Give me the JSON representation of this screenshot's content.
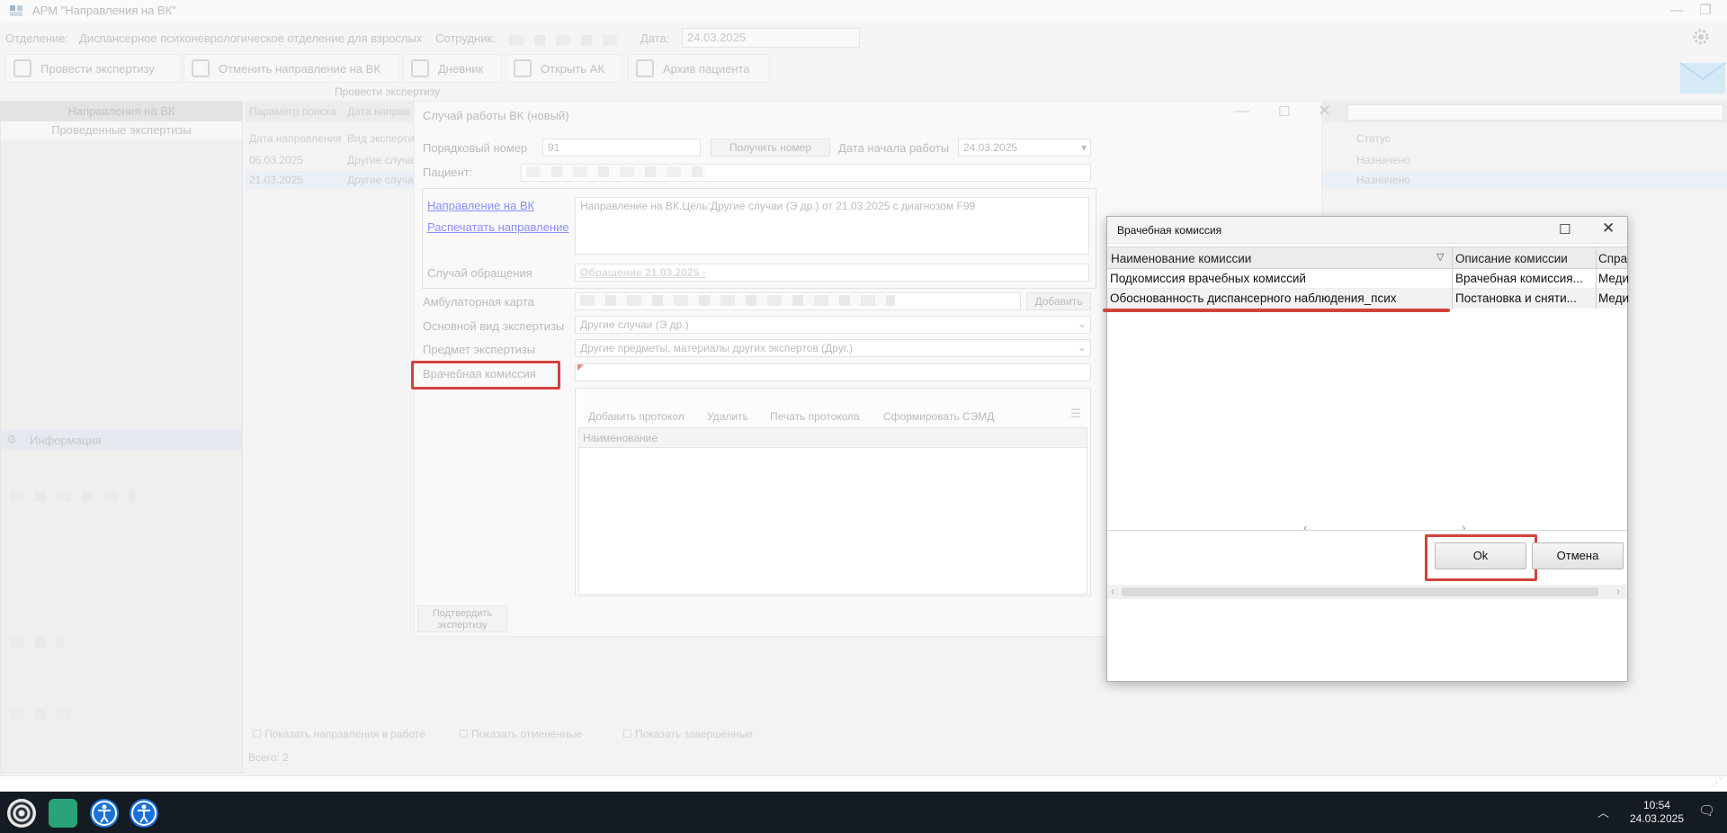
{
  "window": {
    "title": "АРМ \"Направления на ВК\""
  },
  "header": {
    "department_label": "Отделение:",
    "department_value": "Диспансерное психоневрологическое отделение для взрослых",
    "employee_label": "Сотрудник:",
    "date_label": "Дата:",
    "date_value": "24.03.2025"
  },
  "toolbar": {
    "btn_expertise": "Провести экспертизу",
    "btn_cancel_dir": "Отменить направление на ВК",
    "btn_diary": "Дневник",
    "btn_open_ak": "Открыть АК",
    "btn_archive": "Архив пациента",
    "group_label": "Провести экспертизу"
  },
  "left_panel": {
    "header": "Направления на ВК",
    "sub": "Проведенные экспертизы",
    "info_label": "Информация"
  },
  "grid": {
    "search_col": "Параметр поиска",
    "date_col_short": "Дата направ",
    "col_date": "Дата направления",
    "col_type": "Вид экспертиз",
    "col_status": "Статус",
    "rows": [
      {
        "date": "06.03.2025",
        "type": "Другие случа",
        "status": "Назначено"
      },
      {
        "date": "21.03.2025",
        "type": "Другие случа",
        "status": "Назначено"
      }
    ],
    "chk_in_work": "Показать направления в работе",
    "chk_cancelled": "Показать отмененные",
    "chk_completed": "Показать завершенные",
    "total": "Всего:   2"
  },
  "vk_case": {
    "title": "Случай работы ВК (новый)",
    "order_label": "Порядковый номер",
    "order_value": "91",
    "get_number_btn": "Получить номер",
    "start_date_label": "Дата начала работы",
    "start_date_value": "24.03.2025",
    "patient_label": "Пациент:",
    "link_direction": "Направление на ВК",
    "link_print": "Распечатать направление",
    "direction_text": "Направление на ВК.Цель:Другие случаи (Э др.) от 21.03.2025 с диагнозом F99",
    "case_label": "Случай обращения",
    "case_value": "Обращение 21.03.2025 -",
    "card_label": "Амбулаторная карта",
    "add_btn": "Добавить",
    "exp_type_label": "Основной вид экспертизы",
    "exp_type_value": "Другие случаи (Э др.)",
    "subject_label": "Предмет экспертизы",
    "subject_value": "Другие предметы, материалы других экспертов (Друг.)",
    "commission_label": "Врачебная комиссия",
    "proto_add": "Добавить протокол",
    "proto_del": "Удалить",
    "proto_print": "Печать протокола",
    "proto_semd": "Сформировать СЭМД",
    "proto_col_name": "Наименование",
    "confirm_btn": "Подтвердить экспертизу"
  },
  "commission_dialog": {
    "title": "Врачебная комиссия",
    "col_name": "Наименование комиссии",
    "col_desc": "Описание комиссии",
    "col_ref": "Спра",
    "rows": [
      {
        "name": "Подкомиссия врачебных комиссий",
        "desc": "Врачебная комиссия...",
        "ref": "Меди"
      },
      {
        "name": "Обоснованность диспансерного наблюдения_псих",
        "desc": "Постановка и сняти...",
        "ref": "Меди"
      }
    ],
    "ok_label": "Ok",
    "cancel_label": "Отмена"
  },
  "taskbar": {
    "time": "10:54",
    "date": "24.03.2025"
  },
  "colors": {
    "accent_red": "#d1433e",
    "link": "#8b90ff",
    "taskbar": "#151b22"
  }
}
